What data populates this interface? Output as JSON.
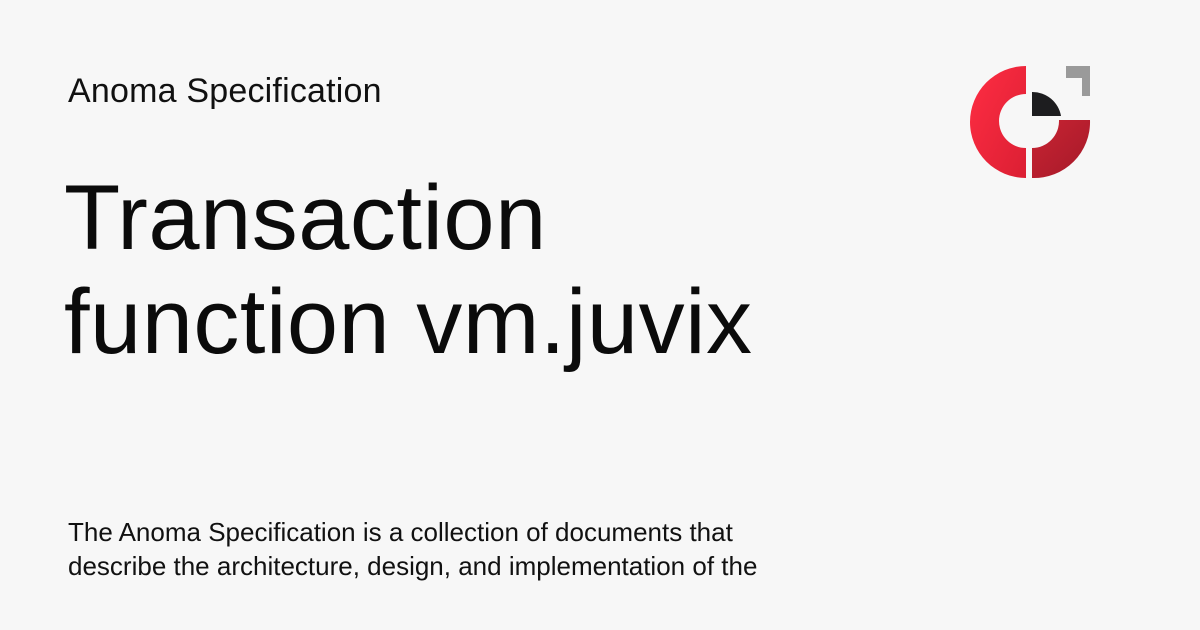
{
  "site": {
    "name": "Anoma Specification"
  },
  "page": {
    "title_lines": [
      "Transaction",
      "function vm.juvix"
    ],
    "description_lines": [
      "The Anoma Specification is a collection of documents that",
      "describe the architecture, design, and implementation of the"
    ]
  },
  "logo": {
    "icon": "anoma-logo-icon",
    "colors": {
      "red": "#f0223a",
      "dark_red": "#b91c2b",
      "gray": "#9a9a9a",
      "black": "#1d1d1f"
    }
  }
}
